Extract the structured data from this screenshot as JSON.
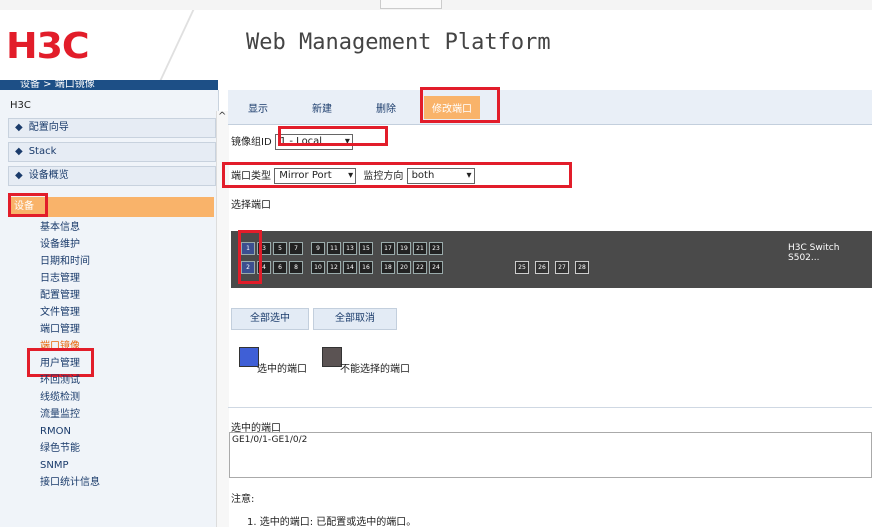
{
  "header": {
    "logo": "H3C",
    "platform_title": "Web Management Platform"
  },
  "breadcrumb": "设备 > 端口镜像",
  "sidebar": {
    "root": "H3C",
    "categories": [
      {
        "label": "配置向导"
      },
      {
        "label": "Stack"
      },
      {
        "label": "设备概览"
      }
    ],
    "selected_category": "设备",
    "items": [
      {
        "label": "基本信息"
      },
      {
        "label": "设备维护"
      },
      {
        "label": "日期和时间"
      },
      {
        "label": "日志管理"
      },
      {
        "label": "配置管理"
      },
      {
        "label": "文件管理"
      },
      {
        "label": "端口管理"
      },
      {
        "label": "端口镜像"
      },
      {
        "label": "用户管理"
      },
      {
        "label": "环回测试"
      },
      {
        "label": "线缆检测"
      },
      {
        "label": "流量监控"
      },
      {
        "label": "RMON"
      },
      {
        "label": "绿色节能"
      },
      {
        "label": "SNMP"
      },
      {
        "label": "接口统计信息"
      }
    ]
  },
  "tabs": [
    {
      "label": "显示"
    },
    {
      "label": "新建"
    },
    {
      "label": "删除"
    },
    {
      "label": "修改端口"
    }
  ],
  "form": {
    "mirror_group_label": "镜像组ID",
    "mirror_group_value": "1 - Local",
    "port_type_label": "端口类型",
    "port_type_value": "Mirror Port",
    "direction_label": "监控方向",
    "direction_value": "both",
    "select_port_label": "选择端口"
  },
  "switch": {
    "model_label": "H3C Switch S502...",
    "top_ports": [
      "1",
      "3",
      "5",
      "7",
      "9",
      "11",
      "13",
      "15",
      "17",
      "19",
      "21",
      "23"
    ],
    "bottom_ports": [
      "2",
      "4",
      "6",
      "8",
      "10",
      "12",
      "14",
      "16",
      "18",
      "20",
      "22",
      "24"
    ],
    "sfp_ports": [
      "25",
      "26",
      "27",
      "28"
    ],
    "selected_ports": [
      "1",
      "2"
    ]
  },
  "buttons": {
    "select_all": "全部选中",
    "deselect_all": "全部取消"
  },
  "legend": {
    "selected_label": "选中的端口",
    "unavailable_label": "不能选择的端口",
    "selected_color": "#3f5fd6",
    "unavailable_color": "#5b5353"
  },
  "selected_ports_section": {
    "title": "选中的端口",
    "value": "GE1/0/1-GE1/0/2"
  },
  "notes": {
    "title": "注意:",
    "item1": "1. 选中的端口: 已配置或选中的端口。"
  }
}
